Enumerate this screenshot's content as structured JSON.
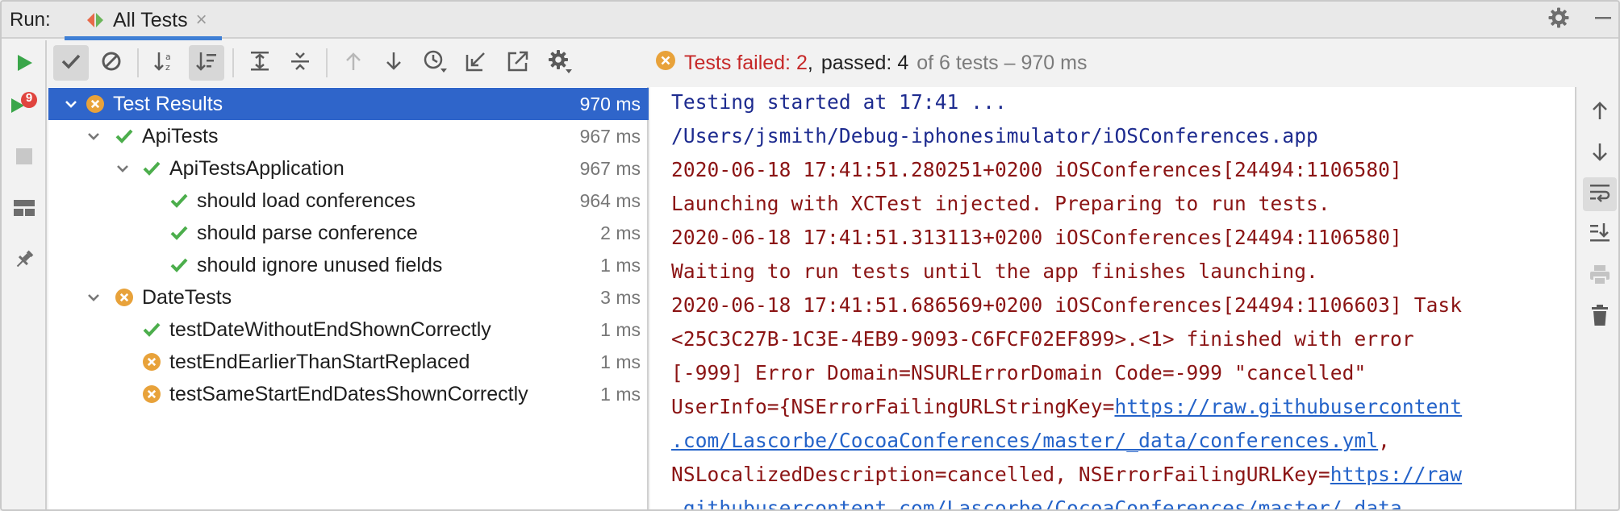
{
  "run_label": "Run:",
  "tab": {
    "label": "All Tests",
    "close": "×"
  },
  "status": {
    "failed_text": "Tests failed: 2",
    "sep": ",",
    "passed_text": "passed: 4",
    "rest_text": "of 6 tests – 970 ms"
  },
  "rerun_badge": "9",
  "tree": {
    "rows": [
      {
        "label": "Test Results",
        "time": "970 ms",
        "status": "failed"
      },
      {
        "label": "ApiTests",
        "time": "967 ms",
        "status": "passed"
      },
      {
        "label": "ApiTestsApplication",
        "time": "967 ms",
        "status": "passed"
      },
      {
        "label": "should load conferences",
        "time": "964 ms",
        "status": "passed"
      },
      {
        "label": "should parse conference",
        "time": "2 ms",
        "status": "passed"
      },
      {
        "label": "should ignore unused fields",
        "time": "1 ms",
        "status": "passed"
      },
      {
        "label": "DateTests",
        "time": "3 ms",
        "status": "failed"
      },
      {
        "label": "testDateWithoutEndShownCorrectly",
        "time": "1 ms",
        "status": "passed"
      },
      {
        "label": "testEndEarlierThanStartReplaced",
        "time": "1 ms",
        "status": "failed"
      },
      {
        "label": "testSameStartEndDatesShownCorrectly",
        "time": "1 ms",
        "status": "failed"
      }
    ]
  },
  "console": {
    "lines": [
      "Testing started at 17:41 ...",
      "/Users/jsmith/Debug-iphonesimulator/iOSConferences.app",
      "2020-06-18 17:41:51.280251+0200 iOSConferences[24494:1106580]",
      " Launching with XCTest injected. Preparing to run tests.",
      "2020-06-18 17:41:51.313113+0200 iOSConferences[24494:1106580]",
      " Waiting to run tests until the app finishes launching.",
      "2020-06-18 17:41:51.686569+0200 iOSConferences[24494:1106603] Task",
      " <25C3C27B-1C3E-4EB9-9093-C6FCF02EF899>.<1> finished with error",
      " [-999] Error Domain=NSURLErrorDomain Code=-999 \"cancelled\"",
      " UserInfo={NSErrorFailingURLStringKey=",
      "https://raw.githubusercontent",
      " .com/Lascorbe/CocoaConferences/master/_data/conferences.yml",
      ",",
      " NSLocalizedDescription=cancelled, NSErrorFailingURLKey=",
      "https://raw",
      " .githubusercontent.com/Lascorbe/CocoaConferences/master/_data"
    ]
  },
  "colors": {
    "selection": "#2f65ca",
    "passed": "#4cae4c",
    "failed": "#e8a23a",
    "console_blue": "#1d2b8f",
    "console_red": "#8b1414",
    "link": "#2463c9"
  }
}
